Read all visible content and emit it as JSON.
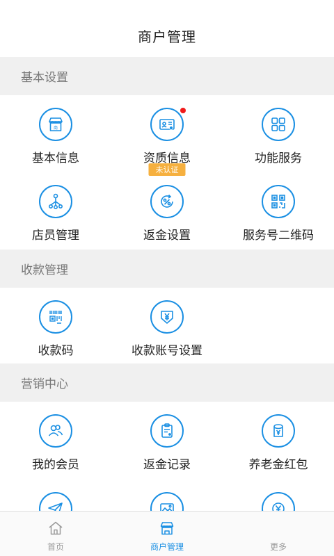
{
  "header": {
    "title": "商户管理"
  },
  "sections": {
    "basic": {
      "title": "基本设置",
      "items": [
        {
          "label": "基本信息",
          "icon": "storefront-icon"
        },
        {
          "label": "资质信息",
          "icon": "id-card-icon",
          "badge": "未认证",
          "dot": true
        },
        {
          "label": "功能服务",
          "icon": "grid-icon"
        },
        {
          "label": "店员管理",
          "icon": "org-tree-icon"
        },
        {
          "label": "返金设置",
          "icon": "rebate-icon"
        },
        {
          "label": "服务号二维码",
          "icon": "qr-code-icon"
        }
      ]
    },
    "collect": {
      "title": "收款管理",
      "items": [
        {
          "label": "收款码",
          "icon": "barcode-icon"
        },
        {
          "label": "收款账号设置",
          "icon": "yen-account-icon"
        }
      ]
    },
    "marketing": {
      "title": "营销中心",
      "items": [
        {
          "label": "我的会员",
          "icon": "members-icon"
        },
        {
          "label": "返金记录",
          "icon": "record-icon"
        },
        {
          "label": "养老金红包",
          "icon": "red-packet-icon"
        },
        {
          "label": "",
          "icon": "paper-plane-icon"
        },
        {
          "label": "",
          "icon": "image-icon"
        },
        {
          "label": "",
          "icon": "yen-coin-icon"
        }
      ]
    }
  },
  "tabbar": {
    "home": "首页",
    "merchant": "商户管理",
    "more": "更多"
  },
  "colors": {
    "accent": "#1a8fe3",
    "badge": "#f6b03f",
    "dot": "#f01a1a"
  }
}
